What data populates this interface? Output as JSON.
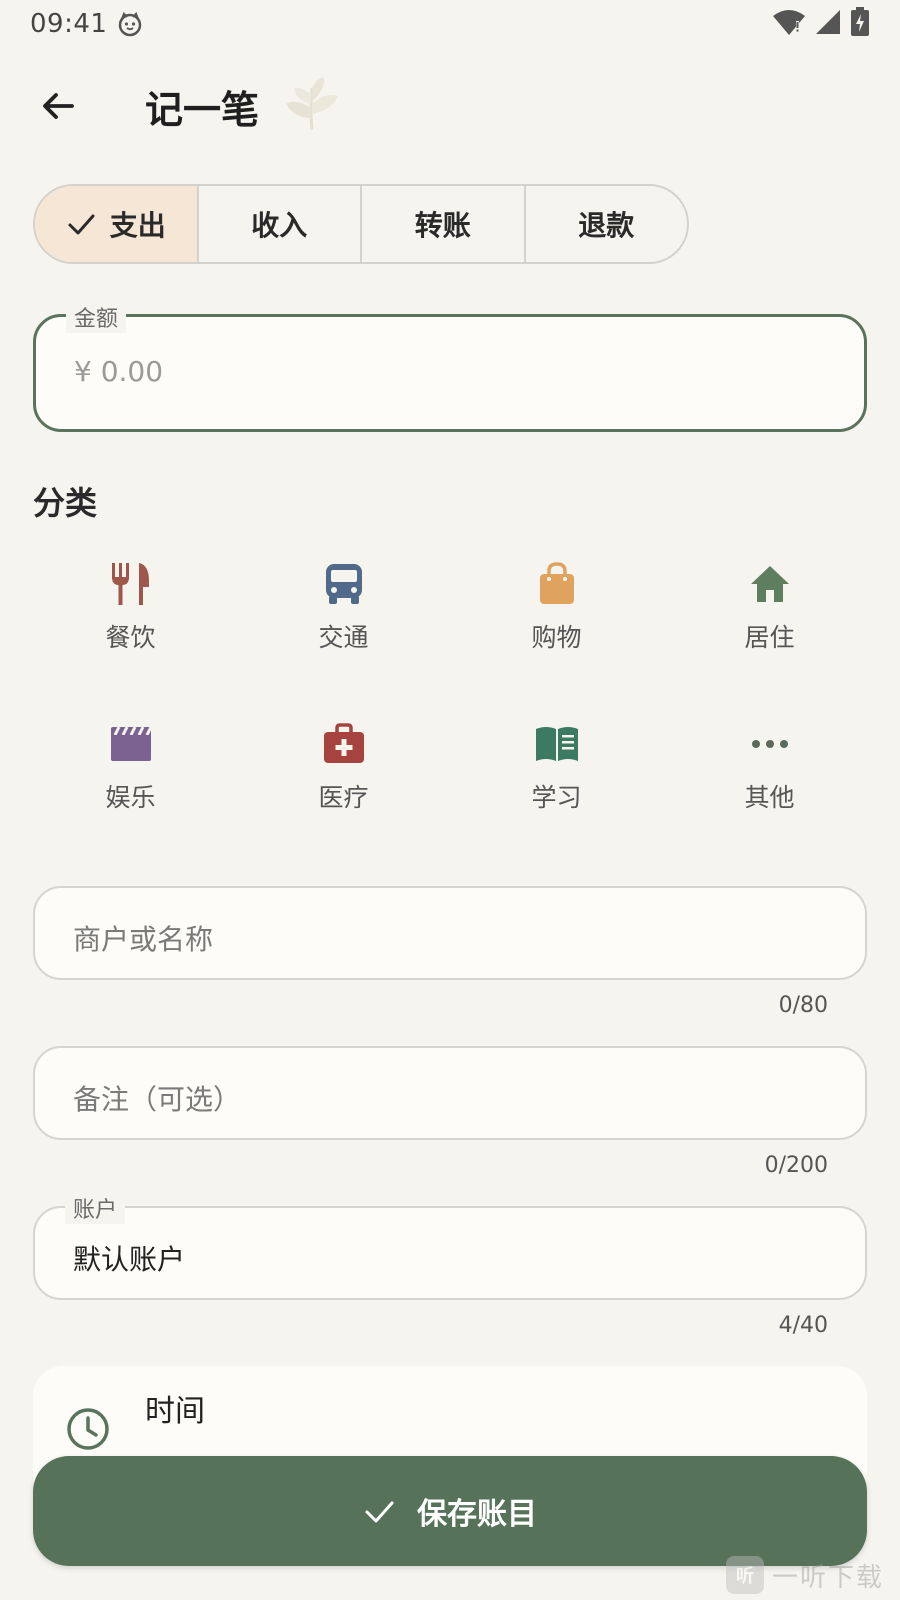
{
  "status_bar": {
    "time": "09:41"
  },
  "header": {
    "title": "记一笔"
  },
  "type_tabs": [
    {
      "label": "支出",
      "selected": true
    },
    {
      "label": "收入",
      "selected": false
    },
    {
      "label": "转账",
      "selected": false
    },
    {
      "label": "退款",
      "selected": false
    }
  ],
  "amount": {
    "label": "金额",
    "placeholder": "¥ 0.00"
  },
  "category": {
    "title": "分类",
    "items": [
      {
        "label": "餐饮",
        "icon": "restaurant-icon",
        "color": "#a0574b"
      },
      {
        "label": "交通",
        "icon": "bus-icon",
        "color": "#51698a"
      },
      {
        "label": "购物",
        "icon": "shopping-bag-icon",
        "color": "#e0a35f"
      },
      {
        "label": "居住",
        "icon": "home-icon",
        "color": "#5e7f5f"
      },
      {
        "label": "娱乐",
        "icon": "movie-icon",
        "color": "#7c6291"
      },
      {
        "label": "医疗",
        "icon": "medical-kit-icon",
        "color": "#a6433f"
      },
      {
        "label": "学习",
        "icon": "book-icon",
        "color": "#3c7a63"
      },
      {
        "label": "其他",
        "icon": "more-icon",
        "color": "#5b6a5b"
      }
    ]
  },
  "merchant": {
    "placeholder": "商户或名称",
    "counter": "0/80"
  },
  "note": {
    "placeholder": "备注（可选）",
    "counter": "0/200"
  },
  "account": {
    "label": "账户",
    "value": "默认账户",
    "counter": "4/40"
  },
  "time": {
    "title": "时间"
  },
  "save": {
    "label": "保存账目"
  },
  "watermark": {
    "logo": "听",
    "text": "一听下载"
  },
  "colors": {
    "background": "#f6f4ee",
    "accent": "#567259",
    "selected_tab": "#f5e6d6"
  }
}
